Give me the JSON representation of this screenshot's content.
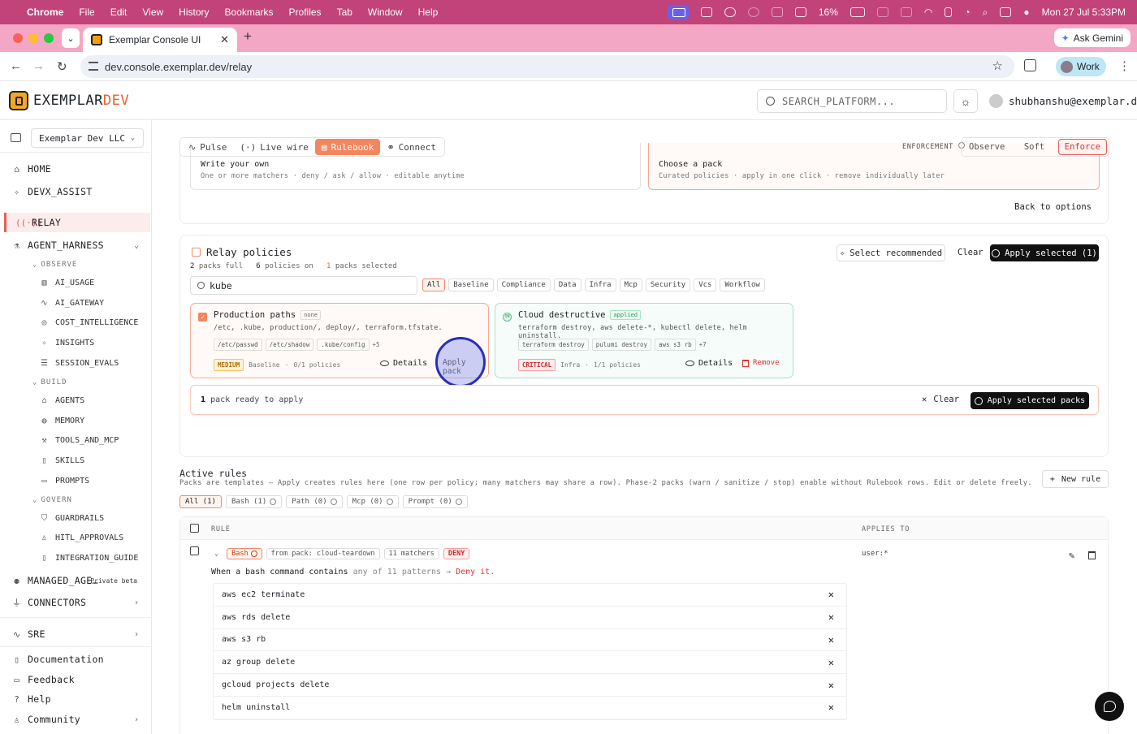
{
  "menubar": {
    "apple": "",
    "app": "Chrome",
    "items": [
      "File",
      "Edit",
      "View",
      "History",
      "Bookmarks",
      "Profiles",
      "Tab",
      "Window",
      "Help"
    ],
    "battery": "16%",
    "datetime": "Mon 27 Jul  5:33PM"
  },
  "browser": {
    "tab_title": "Exemplar Console UI",
    "new_tab": "+",
    "ask_gemini": "Ask Gemini",
    "url": "dev.console.exemplar.dev/relay",
    "profile": "Work"
  },
  "header": {
    "brand_a": "EXEMPLAR",
    "brand_b": "DEV",
    "search_placeholder": "SEARCH_PLATFORM...",
    "user": "shubhanshu@exemplar.dev"
  },
  "sidebar": {
    "org": "Exemplar Dev LLC",
    "home": "HOME",
    "devx": "DEVX_ASSIST",
    "relay": "RELAY",
    "agent_harness": "AGENT_HARNESS",
    "observe": "OBSERVE",
    "ai_usage": "AI_USAGE",
    "ai_gateway": "AI_GATEWAY",
    "cost": "COST_INTELLIGENCE",
    "insights": "INSIGHTS",
    "session_evals": "SESSION_EVALS",
    "build": "BUILD",
    "agents": "AGENTS",
    "memory": "MEMORY",
    "tools": "TOOLS_AND_MCP",
    "skills": "SKILLS",
    "prompts": "PROMPTS",
    "govern": "GOVERN",
    "guardrails": "GUARDRAILS",
    "hitl": "HITL_APPROVALS",
    "integration": "INTEGRATION_GUIDE",
    "managed": "MANAGED_AGE…",
    "private_beta": "Private beta",
    "connectors": "CONNECTORS",
    "sre": "SRE",
    "documentation": "Documentation",
    "feedback": "Feedback",
    "help": "Help",
    "community": "Community"
  },
  "subnav": {
    "tabs": [
      "Pulse",
      "Live wire",
      "Rulebook",
      "Connect"
    ],
    "enforcement_label": "ENFORCEMENT",
    "enforcement_modes": [
      "Observe",
      "Soft",
      "Enforce"
    ],
    "enforcement_selected": "Enforce"
  },
  "options": {
    "write_title": "Write your own",
    "write_desc": "One or more matchers · deny / ask / allow · editable anytime",
    "pack_title": "Choose a pack",
    "pack_desc": "Curated policies · apply in one click · remove individually later",
    "back": "Back to options"
  },
  "relay_policies": {
    "title": "Relay policies",
    "stat1_n": "2",
    "stat1_l": "packs full",
    "stat2_n": "6",
    "stat2_l": "policies on",
    "stat3_n": "1",
    "stat3_l": "packs selected",
    "select_recommended": "Select recommended",
    "clear": "Clear",
    "apply_selected": "Apply selected (1)",
    "search_value": "kube",
    "filters": [
      "All",
      "Baseline",
      "Compliance",
      "Data",
      "Infra",
      "Mcp",
      "Security",
      "Vcs",
      "Workflow"
    ],
    "filter_selected": "All",
    "packs": [
      {
        "name": "Production paths",
        "tag": "none",
        "commands": "/etc, .kube, production/, deploy/, terraform.tfstate.",
        "pills": [
          "/etc/passwd",
          "/etc/shadow",
          ".kube/config"
        ],
        "more": "+5",
        "severity": "MEDIUM",
        "category": "Baseline",
        "policies": "0/1 policies",
        "details": "Details",
        "action": "Apply pack",
        "selected": true
      },
      {
        "name": "Cloud destructive",
        "tag": "applied",
        "badge": "ON",
        "commands": "terraform destroy, aws delete-*, kubectl delete, helm uninstall.",
        "pills": [
          "terraform destroy",
          "pulumi destroy",
          "aws s3 rb"
        ],
        "more": "+7",
        "severity": "CRITICAL",
        "category": "Infra",
        "policies": "1/1 policies",
        "details": "Details",
        "action": "Remove",
        "selected": false
      }
    ],
    "ready_count": "1",
    "ready_text": "pack ready to apply",
    "ready_clear": "Clear",
    "apply_packs": "Apply selected packs"
  },
  "active_rules": {
    "title": "Active rules",
    "description": "Packs are templates — Apply creates rules here (one row per policy; many matchers may share a row). Phase-2 packs (warn / sanitize / stop) enable without Rulebook rows. Edit or delete freely.",
    "new_rule": "New rule",
    "filters": [
      "All (1)",
      "Bash (1)",
      "Path (0)",
      "Mcp (0)",
      "Prompt (0)"
    ],
    "col_rule": "RULE",
    "col_applies": "APPLIES TO",
    "row": {
      "type": "Bash",
      "source": "from pack: cloud-teardown",
      "matchers": "11 matchers",
      "effect": "DENY",
      "when_a": "When a bash command contains",
      "when_b": "any of 11 patterns →",
      "when_c": "Deny it.",
      "applies_to": "user:*",
      "patterns": [
        "aws ec2 terminate",
        "aws rds delete",
        "aws s3 rb",
        "az group delete",
        "gcloud projects delete",
        "helm uninstall"
      ]
    }
  },
  "colors": {
    "accent": "#f4865e",
    "menubar": "#c1437a",
    "tabbar": "#f4a7c4",
    "critical": "#d33",
    "ok": "#5fbf8f"
  }
}
